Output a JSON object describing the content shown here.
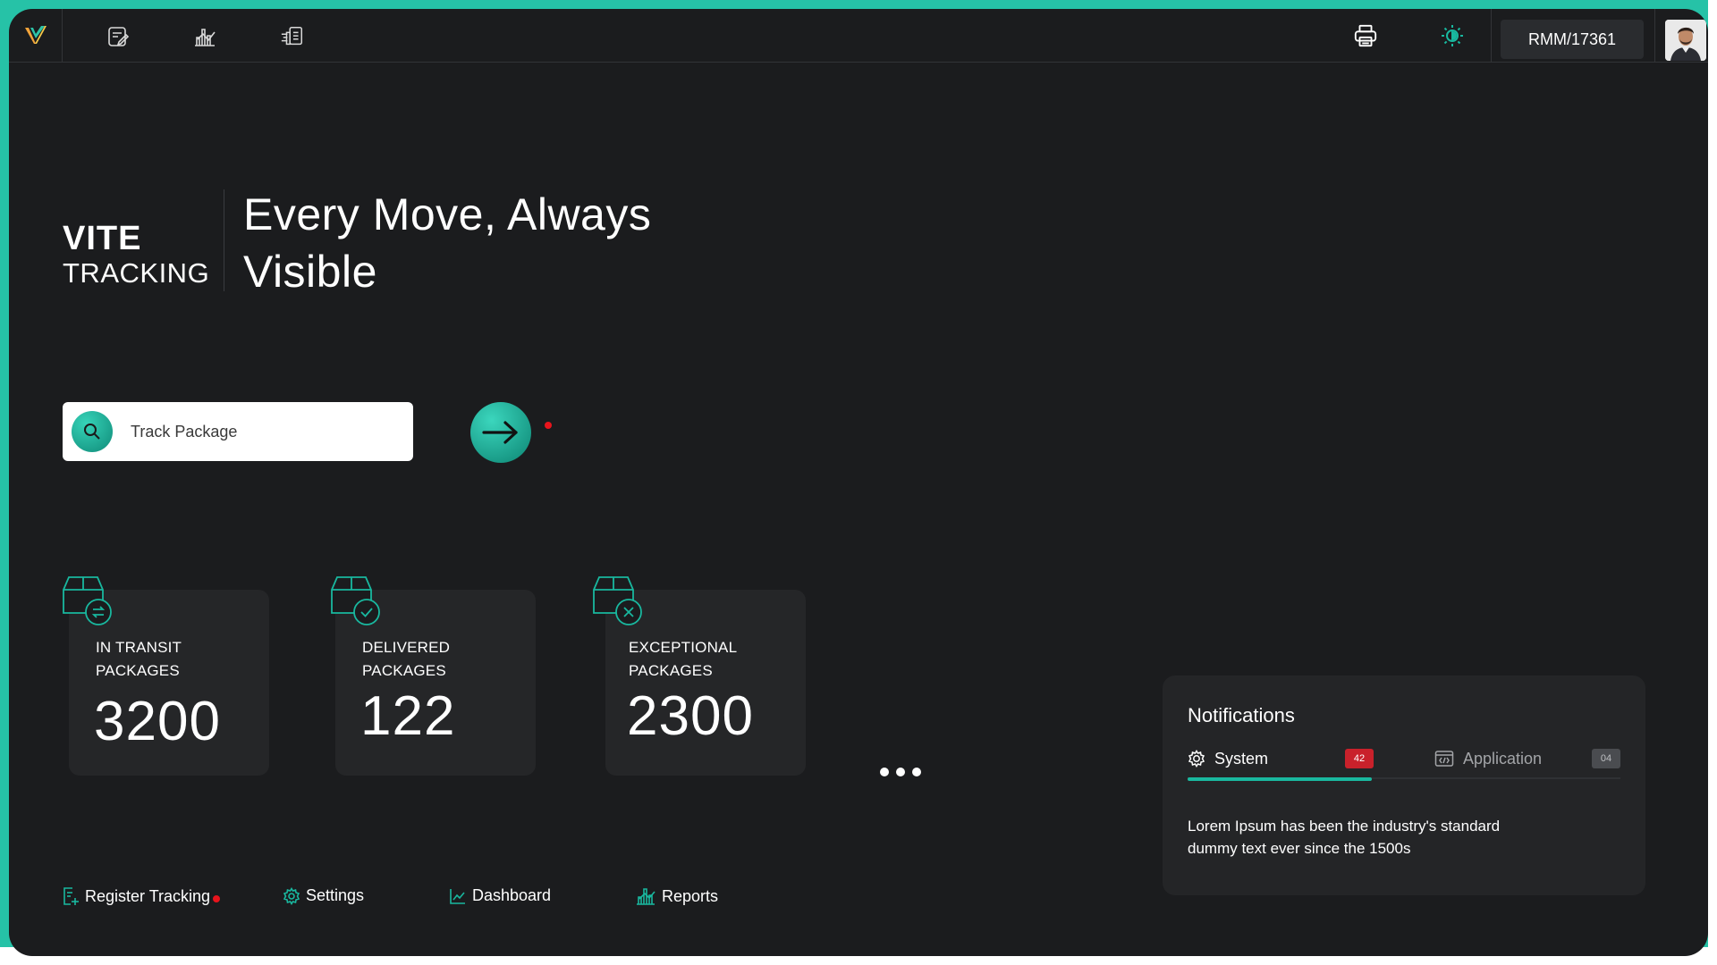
{
  "topbar": {
    "logo_icon": "vite-logo-icon",
    "nav_icons": [
      "notes-icon",
      "analytics-icon",
      "shipment-icon"
    ],
    "print_icon": "printer-icon",
    "theme_icon": "sun-icon",
    "user_id": "RMM/17361",
    "avatar": "user-avatar"
  },
  "hero": {
    "brand_line1": "VITE",
    "brand_line2": "TRACKING",
    "tagline_line1": "Every Move, Always",
    "tagline_line2": "Visible"
  },
  "search": {
    "placeholder": "Track Package",
    "value": ""
  },
  "stats": [
    {
      "label_line1": "IN TRANSIT",
      "label_line2": "PACKAGES",
      "value": "3200",
      "icon": "package-transit-icon"
    },
    {
      "label_line1": "DELIVERED",
      "label_line2": "PACKAGES",
      "value": "122",
      "icon": "package-delivered-icon"
    },
    {
      "label_line1": "EXCEPTIONAL",
      "label_line2": "PACKAGES",
      "value": "2300",
      "icon": "package-exception-icon"
    }
  ],
  "bottom_nav": {
    "register": "Register Tracking",
    "settings": "Settings",
    "dashboard": "Dashboard",
    "reports": "Reports"
  },
  "notifications": {
    "title": "Notifications",
    "tabs": [
      {
        "label": "System",
        "count": "42"
      },
      {
        "label": "Application",
        "count": "04"
      }
    ],
    "message_line1": "Lorem Ipsum has been the industry's standard",
    "message_line2": "dummy text ever since the 1500s"
  },
  "colors": {
    "accent": "#19b89f",
    "background": "#1b1c1e",
    "card": "#252628",
    "alert_red": "#e8141c",
    "badge_red": "#c9212b",
    "badge_gray": "#4a4c50"
  }
}
